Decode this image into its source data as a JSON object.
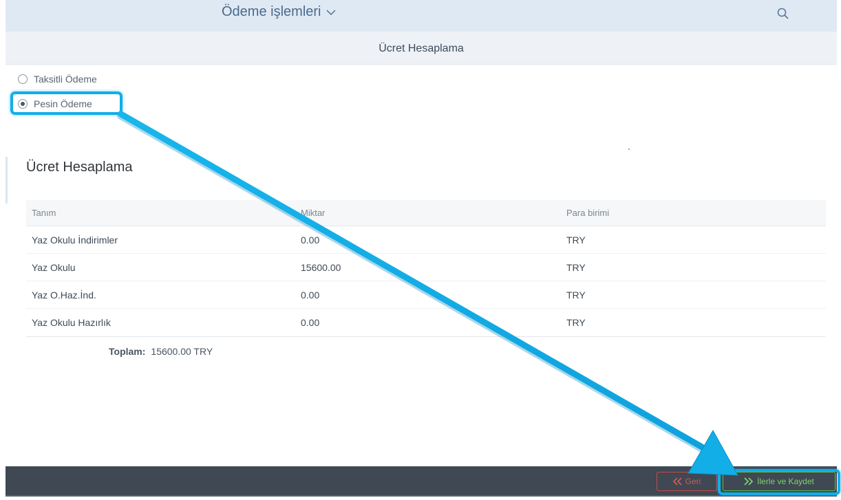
{
  "shell": {
    "title": "Ödeme işlemleri",
    "search_icon": "search-icon",
    "chevron_icon": "chevron-down-icon"
  },
  "page": {
    "title": "Ücret Hesaplama"
  },
  "payment_options": {
    "installment_label": "Taksitli Ödeme",
    "cash_label": "Pesin Ödeme",
    "selected": "cash"
  },
  "fee_section": {
    "title": "Ücret Hesaplama",
    "columns": [
      "Tanım",
      "Miktar",
      "Para birimi"
    ],
    "rows": [
      [
        "Yaz Okulu İndirimler",
        "0.00",
        "TRY"
      ],
      [
        "Yaz Okulu",
        "15600.00",
        "TRY"
      ],
      [
        "Yaz O.Haz.İnd.",
        "0.00",
        "TRY"
      ],
      [
        "Yaz Okulu Hazırlık",
        "0.00",
        "TRY"
      ]
    ],
    "total_label": "Toplam:",
    "total_value": "15600.00 TRY"
  },
  "footer": {
    "back_label": "Geri",
    "next_label": "İlerle ve Kaydet"
  },
  "colors": {
    "shell_bg": "#dfe9f4",
    "header_bg": "#eef2f7",
    "footer_bg": "#3f4853",
    "annotation": "#12aee8",
    "back_button": "#c94a4a",
    "next_button": "#5bbf4a"
  }
}
